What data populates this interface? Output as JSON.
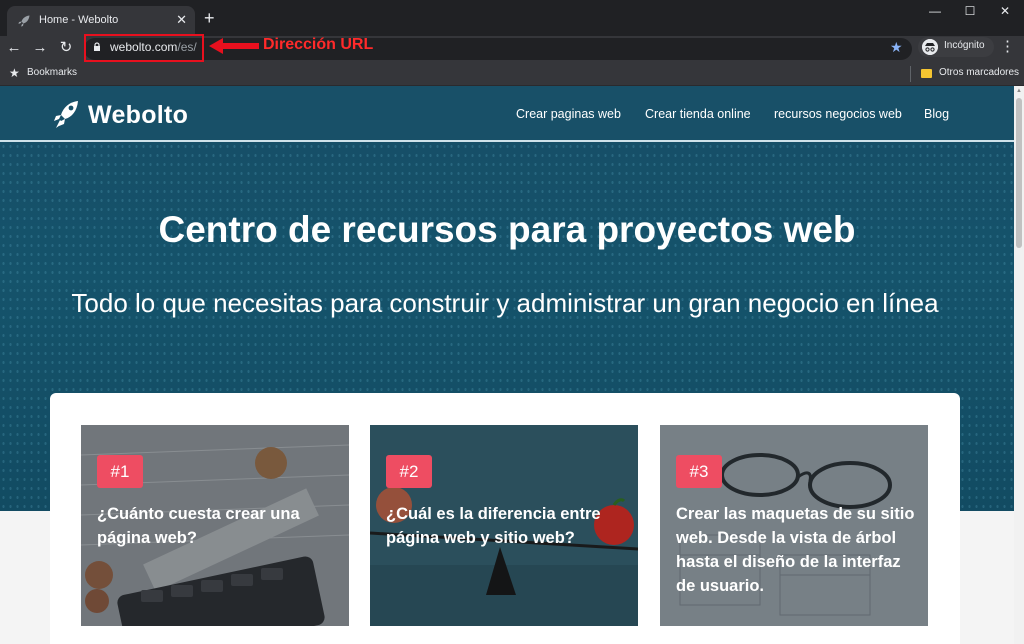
{
  "browser": {
    "tab_title": "Home - Webolto",
    "tab_close": "✕",
    "new_tab": "+",
    "window_controls": {
      "minimize": "—",
      "maximize": "☐",
      "close": "✕"
    },
    "nav": {
      "back": "←",
      "forward": "→",
      "reload": "↻"
    },
    "url_host": "webolto.com",
    "url_path": "/es/",
    "annotation_label": "Dirección URL",
    "annotation_color": "#e8101e",
    "star": "★",
    "profile_label": "Incógnito",
    "menu": "⋮",
    "bookmarks_label": "Bookmarks",
    "bookmarks_star": "★",
    "other_bookmarks": "Otros marcadores"
  },
  "site": {
    "logo_text": "Webolto",
    "brand_color": "#185068",
    "nav": [
      {
        "label": "Crear paginas web"
      },
      {
        "label": "Crear tienda online"
      },
      {
        "label": "recursos negocios web"
      },
      {
        "label": "Blog"
      }
    ],
    "hero_title": "Centro de recursos para proyectos web",
    "hero_subtitle": "Todo lo que necesitas para construir y administrar un gran negocio en línea",
    "badge_color": "#ee4d62",
    "cards": [
      {
        "badge": "#1",
        "title": "¿Cuánto cuesta crear una página web?"
      },
      {
        "badge": "#2",
        "title": "¿Cuál es la diferencia entre página web y sitio web?"
      },
      {
        "badge": "#3",
        "title": "Crear las maquetas de su sitio web. Desde la vista de árbol hasta el diseño de la interfaz de usuario."
      }
    ]
  }
}
